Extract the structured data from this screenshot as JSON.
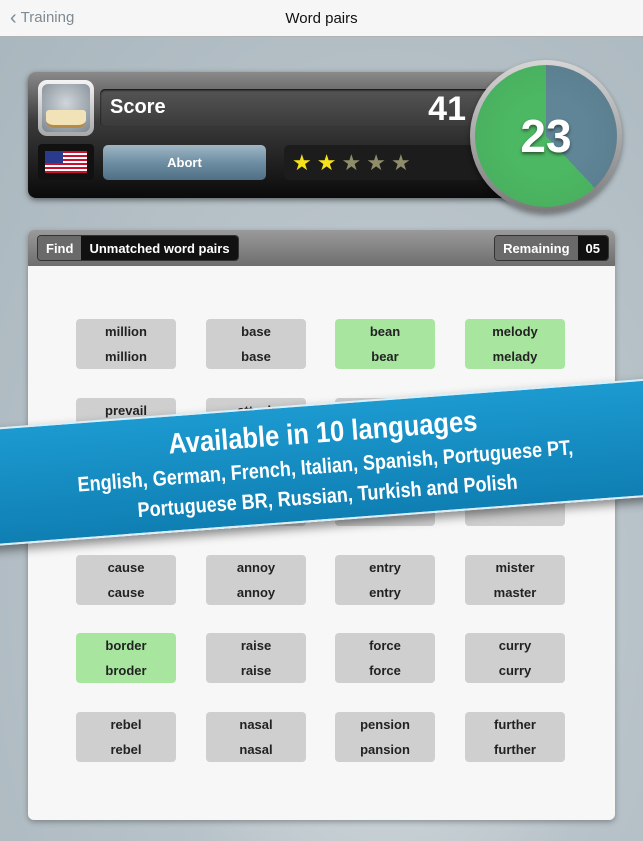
{
  "nav": {
    "back_label": "Training",
    "title": "Word pairs"
  },
  "score": {
    "label": "Score",
    "value": "41",
    "abort_label": "Abort",
    "stars_total": 5,
    "stars_filled": 2,
    "language_flag": "us-flag-icon"
  },
  "timer": {
    "value": "23",
    "fill_fraction": 0.62,
    "fill_color": "#4cb863",
    "track_color": "#5f8596"
  },
  "panel": {
    "find_label": "Find",
    "task": "Unmatched word pairs",
    "remaining_label": "Remaining",
    "remaining_value": "05"
  },
  "cards": [
    {
      "top": "million",
      "bottom": "million",
      "matched": false
    },
    {
      "top": "base",
      "bottom": "base",
      "matched": false
    },
    {
      "top": "bean",
      "bottom": "bear",
      "matched": true
    },
    {
      "top": "melody",
      "bottom": "melady",
      "matched": true
    },
    {
      "top": "prevail",
      "bottom": "",
      "matched": false
    },
    {
      "top": "attack",
      "bottom": "",
      "matched": false
    },
    {
      "top": "",
      "bottom": "",
      "matched": false
    },
    {
      "top": "",
      "bottom": "",
      "matched": false
    },
    {
      "top": "",
      "bottom": "",
      "matched": false
    },
    {
      "top": "",
      "bottom": "",
      "matched": false
    },
    {
      "top": "",
      "bottom": "",
      "matched": false
    },
    {
      "top": "",
      "bottom": "",
      "matched": false
    },
    {
      "top": "cause",
      "bottom": "cause",
      "matched": false
    },
    {
      "top": "annoy",
      "bottom": "annoy",
      "matched": false
    },
    {
      "top": "entry",
      "bottom": "entry",
      "matched": false
    },
    {
      "top": "mister",
      "bottom": "master",
      "matched": false
    },
    {
      "top": "border",
      "bottom": "broder",
      "matched": true
    },
    {
      "top": "raise",
      "bottom": "raise",
      "matched": false
    },
    {
      "top": "force",
      "bottom": "force",
      "matched": false
    },
    {
      "top": "curry",
      "bottom": "curry",
      "matched": false
    },
    {
      "top": "rebel",
      "bottom": "rebel",
      "matched": false
    },
    {
      "top": "nasal",
      "bottom": "nasal",
      "matched": false
    },
    {
      "top": "pension",
      "bottom": "pansion",
      "matched": false
    },
    {
      "top": "further",
      "bottom": "further",
      "matched": false
    }
  ],
  "banner": {
    "headline": "Available in 10 languages",
    "line1": "English, German, French, Italian, Spanish, Portuguese PT,",
    "line2": "Portuguese BR, Russian, Turkish and Polish",
    "color": "#1a8fc4"
  }
}
